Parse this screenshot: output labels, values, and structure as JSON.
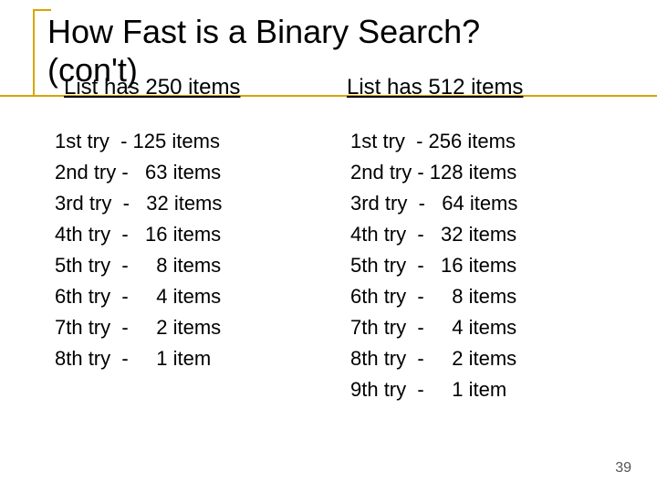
{
  "title_line1": "How Fast is a Binary Search?",
  "title_line2": "(con't)",
  "left": {
    "heading": "List has 250 items",
    "rows": [
      "1st try  - 125 items",
      "2nd try -   63 items",
      "3rd try  -   32 items",
      "4th try  -   16 items",
      "5th try  -     8 items",
      "6th try  -     4 items",
      "7th try  -     2 items",
      "8th try  -     1 item"
    ]
  },
  "right": {
    "heading": "List has 512 items",
    "rows": [
      "1st try  - 256 items",
      "2nd try - 128 items",
      "3rd try  -   64 items",
      "4th try  -   32 items",
      "5th try  -   16 items",
      "6th try  -     8 items",
      "7th try  -     4 items",
      "8th try  -     2 items",
      "9th try  -     1 item"
    ]
  },
  "page_number": "39"
}
